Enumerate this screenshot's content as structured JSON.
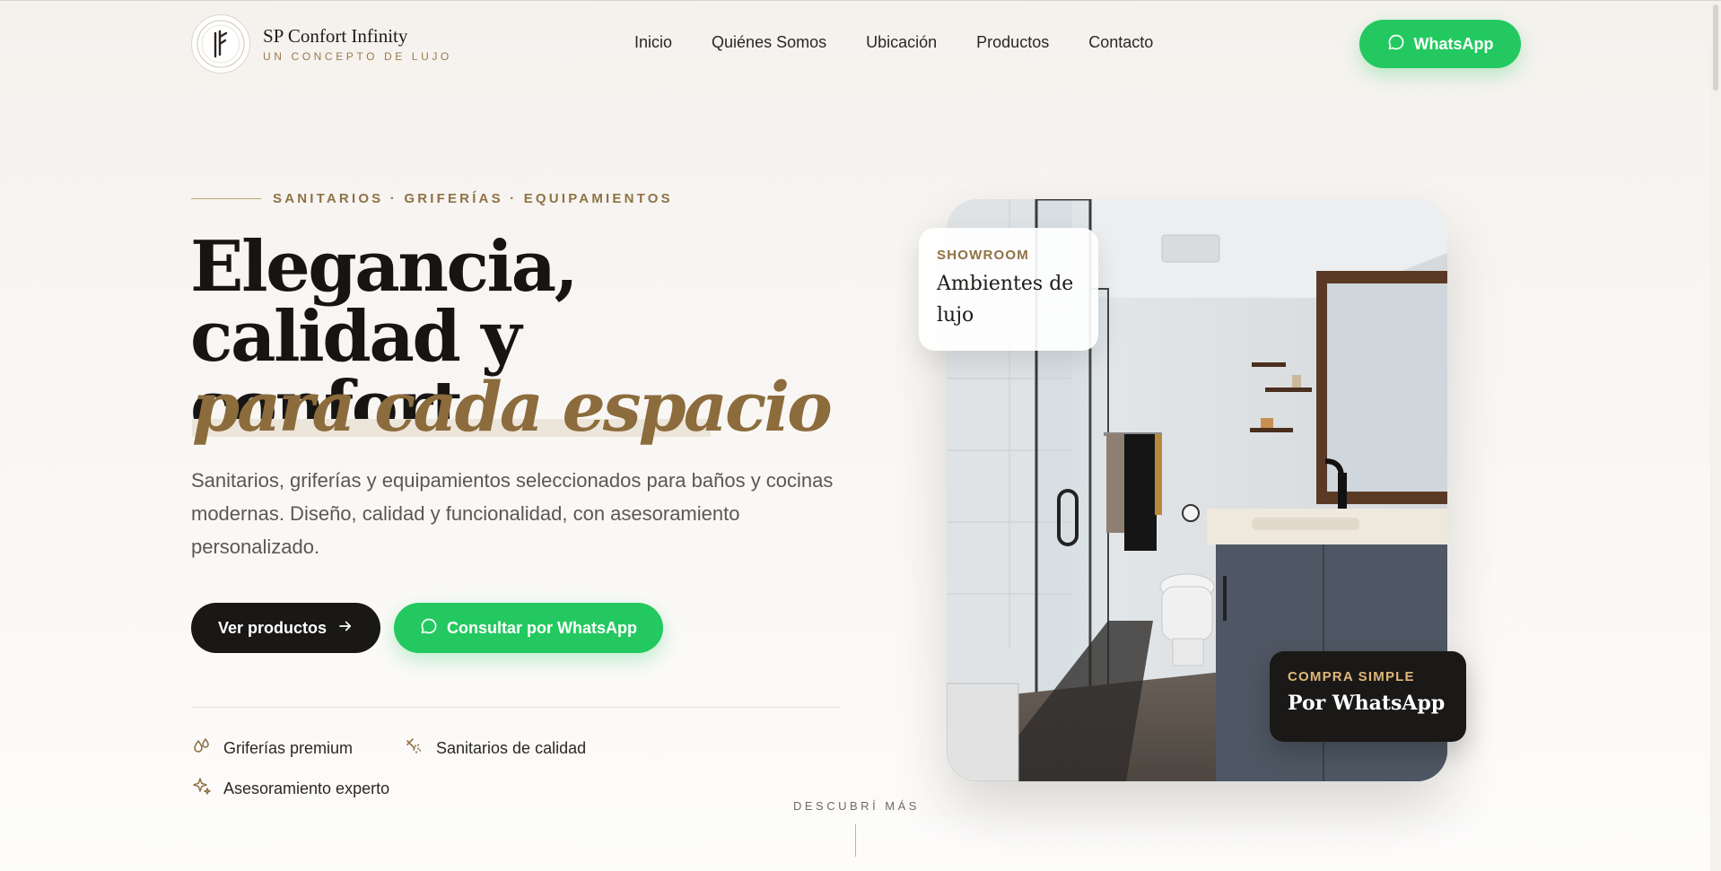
{
  "header": {
    "brand_name": "SP Confort Infinity",
    "brand_tagline": "UN CONCEPTO DE LUJO",
    "nav": [
      {
        "label": "Inicio"
      },
      {
        "label": "Quiénes Somos"
      },
      {
        "label": "Ubicación"
      },
      {
        "label": "Productos"
      },
      {
        "label": "Contacto"
      }
    ],
    "whatsapp_label": "WhatsApp",
    "whatsapp_icon": "whatsapp-icon"
  },
  "hero": {
    "eyebrow": "SANITARIOS · GRIFERÍAS · EQUIPAMIENTOS",
    "title_line1": "Elegancia, calidad y",
    "title_line2": "confort",
    "title_accent": "para cada espacio",
    "lead": "Sanitarios, griferías y equipamientos seleccionados para baños y cocinas modernas. Diseño, calidad y funcionalidad, con asesoramiento personalizado.",
    "primary_button": "Ver productos",
    "secondary_button": "Consultar por WhatsApp",
    "features": [
      {
        "label": "Griferías premium",
        "icon": "droplets-icon"
      },
      {
        "label": "Sanitarios de calidad",
        "icon": "shower-icon"
      },
      {
        "label": "Asesoramiento experto",
        "icon": "sparkles-icon"
      }
    ],
    "discover": "DESCUBRÍ MÁS"
  },
  "showcase": {
    "showroom_label": "SHOWROOM",
    "showroom_title": "Ambientes de lujo",
    "compra_label": "COMPRA SIMPLE",
    "compra_title": "Por WhatsApp"
  },
  "colors": {
    "accent_gold": "#8c6c3c",
    "whatsapp_green": "#23c960",
    "dark": "#1a1816"
  }
}
